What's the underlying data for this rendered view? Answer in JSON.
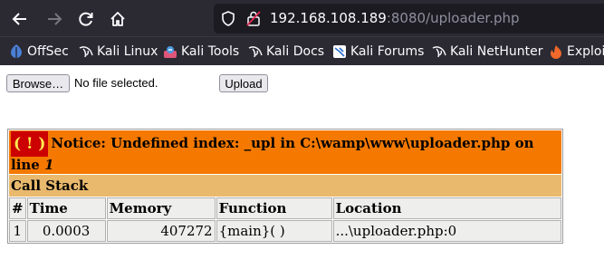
{
  "browser": {
    "url_host": "192.168.108.189",
    "url_rest": ":8080/uploader.php",
    "bookmarks": [
      {
        "label": "OffSec",
        "icon": "offsec-icon"
      },
      {
        "label": "Kali Linux",
        "icon": "kali-dragon-icon"
      },
      {
        "label": "Kali Tools",
        "icon": "kali-tools-icon"
      },
      {
        "label": "Kali Docs",
        "icon": "kali-dragon-icon"
      },
      {
        "label": "Kali Forums",
        "icon": "kali-forums-icon"
      },
      {
        "label": "Kali NetHunter",
        "icon": "kali-dragon-icon"
      },
      {
        "label": "Exploit",
        "icon": "exploit-db-icon"
      }
    ]
  },
  "form": {
    "browse_label": "Browse…",
    "file_status": "No file selected.",
    "upload_label": "Upload"
  },
  "error": {
    "badge": "( ! )",
    "message": "Notice: Undefined index: _upl in C:\\wamp\\www\\uploader.php on line ",
    "line": "1",
    "call_stack_title": "Call Stack",
    "columns": [
      "#",
      "Time",
      "Memory",
      "Function",
      "Location"
    ],
    "rows": [
      {
        "num": "1",
        "time": "0.0003",
        "memory": "407272",
        "function": "{main}( )",
        "location": "...\\uploader.php:0"
      }
    ]
  },
  "colors": {
    "chrome_bg": "#2b2a33",
    "notice_bg": "#f57900",
    "badge_bg": "#cc0000",
    "callstack_bg": "#e9b96e",
    "row_bg": "#eeeeec"
  }
}
